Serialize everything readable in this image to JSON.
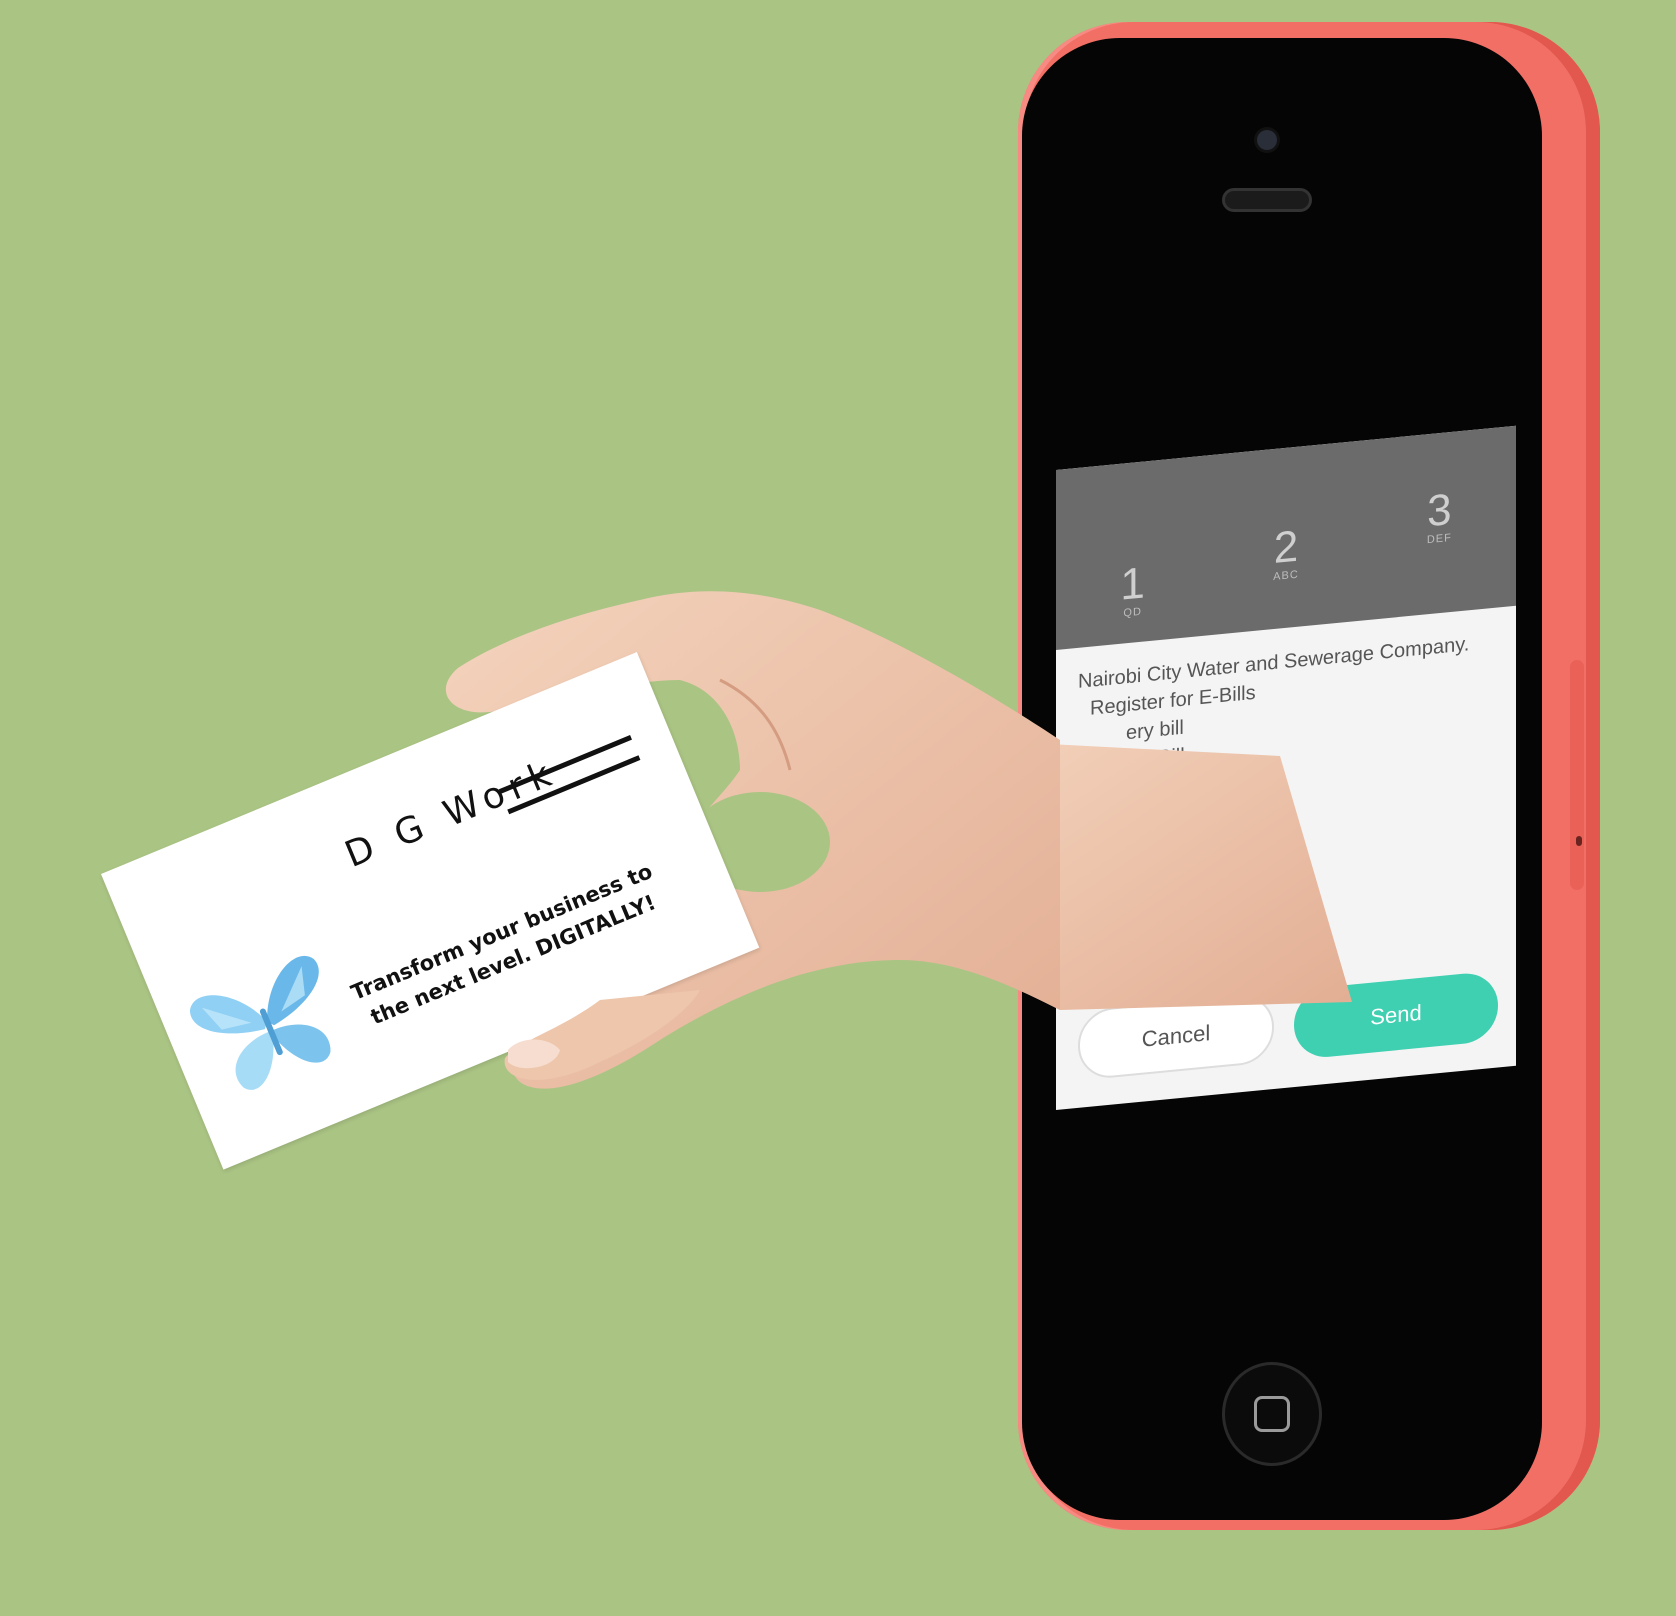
{
  "phone": {
    "keypad": [
      {
        "digit": "1",
        "letters": "QD"
      },
      {
        "digit": "2",
        "letters": "ABC"
      },
      {
        "digit": "3",
        "letters": "DEF"
      }
    ],
    "ussd_lines": [
      "Nairobi City Water and Sewerage Company.",
      "Register for E-Bills",
      "ery bill",
      "Bill"
    ],
    "cancel_label": "Cancel",
    "send_label": "Send"
  },
  "card": {
    "title": "D G Work",
    "tagline_line1": "Transform your business to",
    "tagline_line2": "the next level. DIGITALLY!"
  },
  "colors": {
    "background": "#aac484",
    "phone_case": "#f26f66",
    "send_button": "#3fcfb1",
    "butterfly": "#7ec8f2"
  }
}
